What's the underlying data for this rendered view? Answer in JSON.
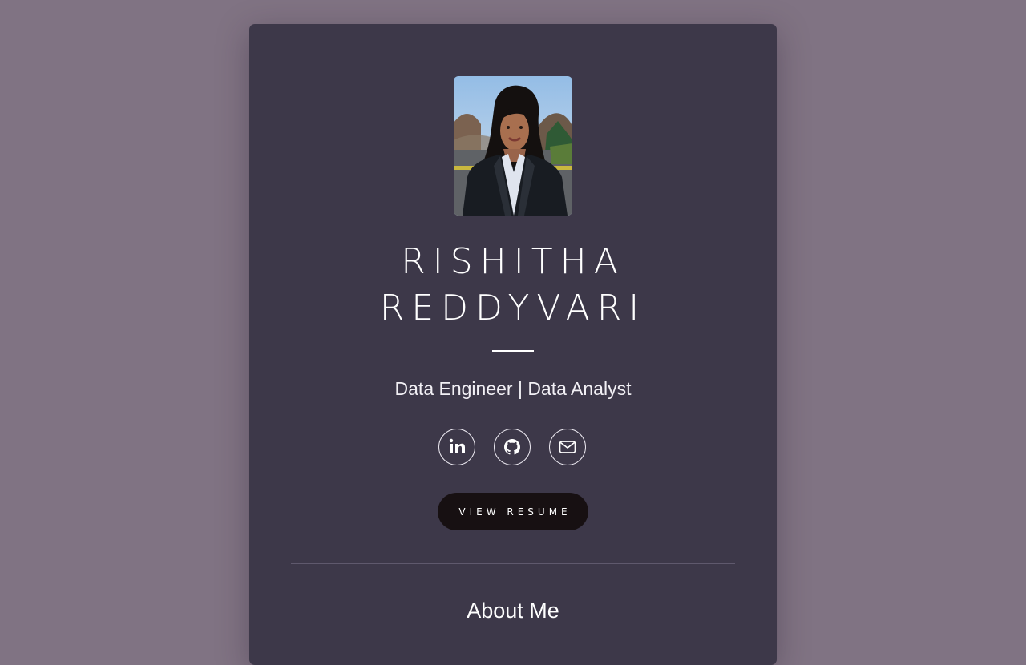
{
  "profile": {
    "name_line1": "RISHITHA",
    "name_line2": "REDDYVARI",
    "title": "Data Engineer | Data Analyst"
  },
  "social": [
    {
      "icon": "linkedin-icon"
    },
    {
      "icon": "github-icon"
    },
    {
      "icon": "mail-icon"
    }
  ],
  "resume_button": "VIEW RESUME",
  "about": {
    "title": "About Me"
  },
  "colors": {
    "page_background": "#807383",
    "card_background": "#3d3849",
    "button_background": "#171012",
    "text": "#ffffff"
  }
}
